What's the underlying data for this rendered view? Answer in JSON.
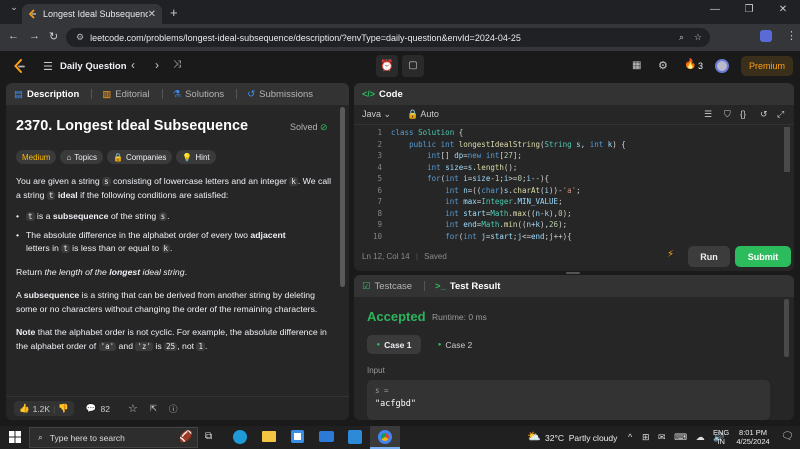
{
  "browser": {
    "tab_title": "Longest Ideal Subsequence - L",
    "url": "leetcode.com/problems/longest-ideal-subsequence/description/?envType=daily-question&envId=2024-04-25"
  },
  "nav": {
    "daily": "Daily Question",
    "streak": "3",
    "premium": "Premium"
  },
  "left_tabs": {
    "description": "Description",
    "editorial": "Editorial",
    "solutions": "Solutions",
    "submissions": "Submissions"
  },
  "problem": {
    "title": "2370. Longest Ideal Subsequence",
    "status": "Solved",
    "difficulty": "Medium",
    "topics": "Topics",
    "companies": "Companies",
    "hint": "Hint",
    "p1_a": "You are given a string ",
    "p1_s": "s",
    "p1_b": " consisting of lowercase letters and an integer ",
    "p1_k": "k",
    "p1_c": ". We call a string ",
    "p1_t": "t",
    "p1_d": "ideal",
    "p1_e": " if the following conditions are satisfied:",
    "b1_t": "t",
    "b1_a": " is a ",
    "b1_b": "subsequence",
    "b1_c": " of the string ",
    "b1_s": "s",
    "b1_d": ".",
    "b2_a": "The absolute difference in the alphabet order of every two ",
    "b2_b": "adjacent",
    "b2_c": " letters in ",
    "b2_t": "t",
    "b2_d": " is less than or equal to ",
    "b2_k": "k",
    "b2_e": ".",
    "r_a": "Return ",
    "r_b": "the length of the ",
    "r_c": "longest",
    "r_d": " ideal string",
    "r_e": ".",
    "s_a": "A ",
    "s_b": "subsequence",
    "s_c": " is a string that can be derived from another string by deleting some or no characters without changing the order of the remaining characters.",
    "n_a": "Note",
    "n_b": " that the alphabet order is not cyclic. For example, the absolute difference in the alphabet order of ",
    "n_c": "'a'",
    "n_d": " and ",
    "n_e": "'z'",
    "n_f": " is ",
    "n_g": "25",
    "n_h": ", not ",
    "n_i": "1",
    "n_j": ".",
    "likes": "1.2K",
    "comments": "82"
  },
  "code_panel": {
    "title": "Code",
    "language": "Java",
    "auto": "Auto",
    "status": "Ln 12, Col 14",
    "saved": "Saved",
    "run": "Run",
    "submit": "Submit"
  },
  "code_lines": [
    {
      "n": "1",
      "html": "<span class='kw'>class</span> <span class='ty'>Solution</span> {"
    },
    {
      "n": "2",
      "html": "    <span class='kw'>public int</span> <span class='fn'>longestIdealString</span>(<span class='ty'>String</span> <span class='va'>s</span>, <span class='kw'>int</span> <span class='va'>k</span>) {"
    },
    {
      "n": "3",
      "html": "        <span class='kw'>int</span>[] <span class='va'>dp</span>=<span class='kw'>new int</span>[<span class='nm'>27</span>];"
    },
    {
      "n": "4",
      "html": "        <span class='kw'>int</span> <span class='va'>size</span>=<span class='va'>s</span>.<span class='fn'>length</span>();"
    },
    {
      "n": "5",
      "html": "        <span class='kw'>for</span>(<span class='kw'>int</span> <span class='va'>i</span>=<span class='va'>size</span>-<span class='nm'>1</span>;<span class='va'>i</span>&gt;=<span class='nm'>0</span>;<span class='va'>i</span>--){"
    },
    {
      "n": "6",
      "html": "            <span class='kw'>int</span> <span class='va'>n</span>=((<span class='kw'>char</span>)<span class='va'>s</span>.<span class='fn'>charAt</span>(<span class='va'>i</span>))-<span class='st'>'a'</span>;"
    },
    {
      "n": "7",
      "html": "            <span class='kw'>int</span> <span class='va'>max</span>=<span class='ty'>Integer</span>.<span class='va'>MIN_VALUE</span>;"
    },
    {
      "n": "8",
      "html": "            <span class='kw'>int</span> <span class='va'>start</span>=<span class='ty'>Math</span>.<span class='fn'>max</span>((<span class='va'>n</span>-<span class='va'>k</span>),<span class='nm'>0</span>);"
    },
    {
      "n": "9",
      "html": "            <span class='kw'>int</span> <span class='va'>end</span>=<span class='ty'>Math</span>.<span class='fn'>min</span>((<span class='va'>n</span>+<span class='va'>k</span>),<span class='nm'>26</span>);"
    },
    {
      "n": "10",
      "html": "            <span class='kw'>for</span>(<span class='kw'>int</span> <span class='va'>j</span>=<span class='va'>start</span>;<span class='va'>j</span>&lt;=<span class='va'>end</span>;<span class='va'>j</span>++){"
    }
  ],
  "test_panel": {
    "testcase": "Testcase",
    "result": "Test Result",
    "accepted": "Accepted",
    "runtime": "Runtime: 0 ms",
    "case1": "Case 1",
    "case2": "Case 2",
    "input_label": "Input",
    "var": "s =",
    "value": "\"acfgbd\""
  },
  "taskbar": {
    "search": "Type here to search",
    "weather": "32°C  Partly cloudy",
    "lang1": "ENG",
    "lang2": "IN",
    "time": "8:01 PM",
    "date": "4/25/2024"
  },
  "colors": {
    "accent_orange": "#ffa116",
    "green": "#2cbb5d",
    "accepted": "#2db55d",
    "medium": "#ffb800"
  }
}
